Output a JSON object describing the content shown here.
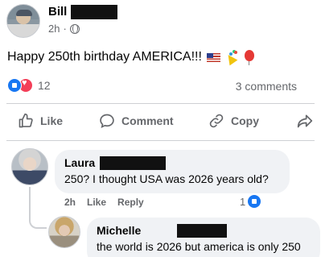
{
  "post": {
    "author": "Bill",
    "time": "2h",
    "dot": "·",
    "text": "Happy 250th birthday AMERICA!!!",
    "reaction_count": "12",
    "comment_count": "3 comments"
  },
  "actions": {
    "like": "Like",
    "comment": "Comment",
    "copy": "Copy"
  },
  "comments": [
    {
      "author": "Laura",
      "text": "250? I thought USA was 2026 years old?",
      "time": "2h",
      "like": "Like",
      "reply": "Reply",
      "likes": "1"
    },
    {
      "author": "Michelle",
      "text": "the world is 2026 but america is only 250"
    }
  ],
  "icons": [
    "globe-icon",
    "flag-icon",
    "party-popper-icon",
    "balloon-icon",
    "like-reaction-icon",
    "love-reaction-icon",
    "thumbs-up-icon",
    "comment-bubble-icon",
    "link-icon",
    "share-arrow-icon"
  ],
  "colors": {
    "accent": "#1877f2",
    "love": "#f33e58",
    "muted_text": "#65676b",
    "bubble": "#f0f2f5"
  }
}
